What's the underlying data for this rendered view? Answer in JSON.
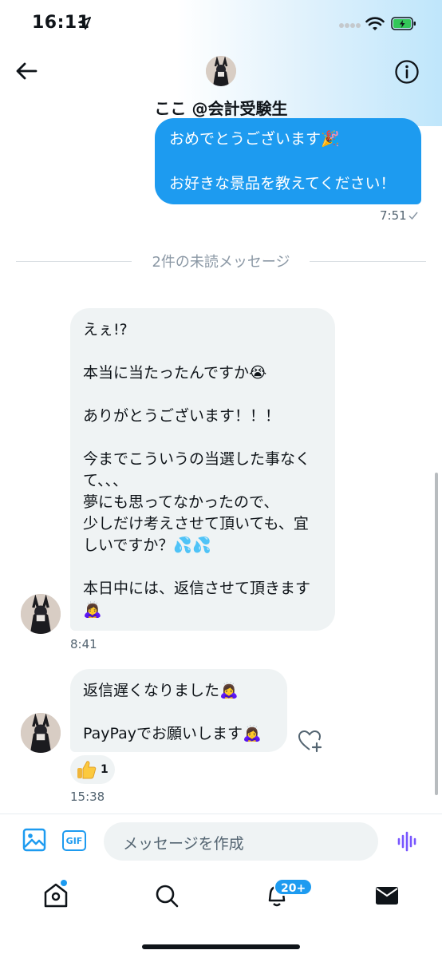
{
  "status_bar": {
    "time": "16:11"
  },
  "header": {
    "title": "ここ @会計受験生",
    "back_icon": "back-arrow-icon",
    "info_icon": "info-icon"
  },
  "messages": {
    "sent": {
      "lines": [
        "おめでとうございます🎉",
        "",
        "お好きな景品を教えてください！"
      ],
      "time": "7:51"
    },
    "unread_divider": "2件の未読メッセージ",
    "received_1": {
      "lines": [
        "えぇ!?",
        "",
        "本当に当たったんですか😭",
        "",
        "ありがとうございます！！！",
        "",
        "今までこういうの当選した事なく",
        "て、、、",
        "夢にも思ってなかったので、",
        "少しだけ考えさせて頂いても、宜",
        "しいですか？💦💦",
        "",
        "本日中には、返信させて頂きます",
        "🙇‍♀️"
      ],
      "time": "8:41"
    },
    "received_2": {
      "lines": [
        "返信遅くなりました🙇‍♀️",
        "",
        "PayPayでお願いします🙇‍♀️"
      ],
      "reaction_count": "1",
      "time": "15:38"
    }
  },
  "composer": {
    "placeholder": "メッセージを作成",
    "gif_label": "GIF"
  },
  "nav": {
    "notifications_badge": "20+"
  },
  "colors": {
    "accent": "#1d9bf0",
    "bubble_received": "#eff3f4",
    "voice_purple": "#7856ff"
  }
}
